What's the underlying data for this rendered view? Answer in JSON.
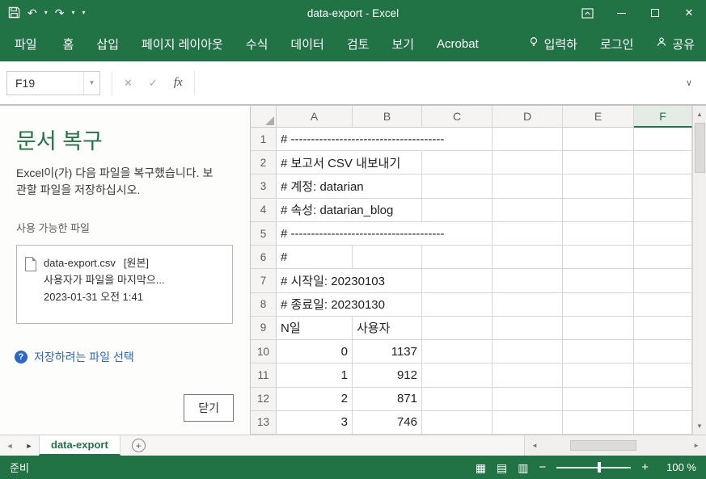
{
  "colors": {
    "excel_green": "#217346",
    "link_blue": "#2b66c9",
    "grid_line": "#d8d6d4",
    "selected_header_bg": "#e3ece5"
  },
  "title_bar": {
    "title": "data-export - Excel"
  },
  "icons": {
    "undo": "↶",
    "redo": "↷",
    "dropdown": "▾",
    "close_window": "✕",
    "cancel": "✕",
    "enter": "✓",
    "expand": "∨",
    "scroll_up": "▲",
    "scroll_down": "▼",
    "sheet_prev": "◄",
    "sheet_next": "►",
    "add_sheet": "+",
    "help": "?",
    "view_normal": "▦",
    "view_layout": "▤",
    "view_break": "▥",
    "zoom_out": "−",
    "zoom_in": "+"
  },
  "ribbon": {
    "tabs": [
      {
        "label": "파일"
      },
      {
        "label": "홈"
      },
      {
        "label": "삽입"
      },
      {
        "label": "페이지 레이아웃"
      },
      {
        "label": "수식"
      },
      {
        "label": "데이터"
      },
      {
        "label": "검토"
      },
      {
        "label": "보기"
      },
      {
        "label": "Acrobat"
      }
    ],
    "tell_me": "입력하",
    "sign_in": "로그인",
    "share": "공유"
  },
  "formula_bar": {
    "name_box": "F19",
    "fx": "fx"
  },
  "recovery": {
    "title": "문서 복구",
    "desc": "Excel이(가) 다음 파일을 복구했습니다. 보관할 파일을 저장하십시오.",
    "available_label": "사용 가능한 파일",
    "file": {
      "name": "data-export.csv",
      "tag": "[원본]",
      "line2": "사용자가 파일을 마지막으...",
      "line3": "2023-01-31 오전 1:41"
    },
    "select_link": "저장하려는 파일 선택",
    "close_button": "닫기"
  },
  "grid": {
    "columns": [
      "A",
      "B",
      "C",
      "D",
      "E",
      "F"
    ],
    "selected_column": "F",
    "rows": [
      {
        "n": "1",
        "a": "# --------------------------------------"
      },
      {
        "n": "2",
        "a": "# 보고서 CSV 내보내기"
      },
      {
        "n": "3",
        "a": "# 계정: datarian"
      },
      {
        "n": "4",
        "a": "# 속성: datarian_blog"
      },
      {
        "n": "5",
        "a": "# --------------------------------------"
      },
      {
        "n": "6",
        "a": "#"
      },
      {
        "n": "7",
        "a": "# 시작일: 20230103"
      },
      {
        "n": "8",
        "a": "# 종료일: 20230130"
      },
      {
        "n": "9",
        "a": "N일",
        "b": "사용자"
      },
      {
        "n": "10",
        "a": "0",
        "b": "1137"
      },
      {
        "n": "11",
        "a": "1",
        "b": "912"
      },
      {
        "n": "12",
        "a": "2",
        "b": "871"
      },
      {
        "n": "13",
        "a": "3",
        "b": "746"
      }
    ]
  },
  "sheet_bar": {
    "tab": "data-export"
  },
  "status_bar": {
    "ready": "준비",
    "zoom": "100 %"
  }
}
